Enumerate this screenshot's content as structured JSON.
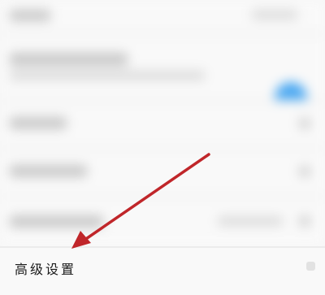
{
  "settings": {
    "advanced_settings_label": "高级设置"
  },
  "annotation": {
    "arrow_color": "#c0262a"
  },
  "colors": {
    "toggle_on": "#4aa8f2",
    "background": "#f7f7f7"
  }
}
